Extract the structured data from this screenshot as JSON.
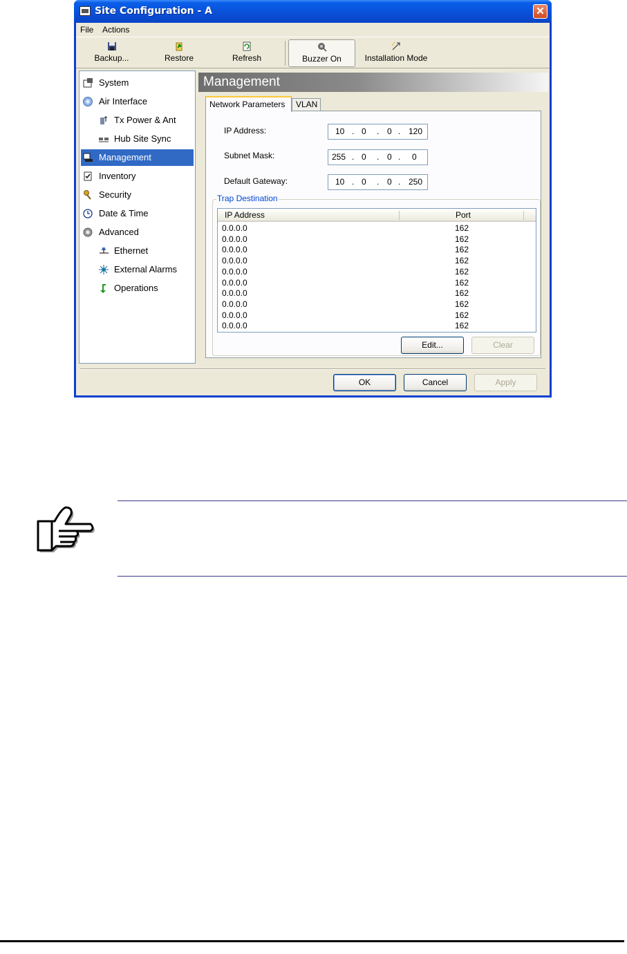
{
  "window": {
    "title": "Site Configuration - A",
    "close_glyph": "✕"
  },
  "menu": [
    "File",
    "Actions"
  ],
  "toolbar": {
    "backup": "Backup...",
    "restore": "Restore",
    "refresh": "Refresh",
    "buzzer": "Buzzer On",
    "installation": "Installation Mode"
  },
  "tree": [
    {
      "label": "System",
      "icon": "system-icon"
    },
    {
      "label": "Air Interface",
      "icon": "air-interface-icon"
    },
    {
      "label": "Tx Power & Ant",
      "icon": "tx-power-icon"
    },
    {
      "label": "Hub Site Sync",
      "icon": "hub-sync-icon"
    },
    {
      "label": "Management",
      "icon": "management-icon",
      "selected": true
    },
    {
      "label": "Inventory",
      "icon": "inventory-icon"
    },
    {
      "label": "Security",
      "icon": "security-icon"
    },
    {
      "label": "Date & Time",
      "icon": "clock-icon"
    },
    {
      "label": "Advanced",
      "icon": "advanced-icon"
    },
    {
      "label": "Ethernet",
      "icon": "ethernet-icon"
    },
    {
      "label": "External Alarms",
      "icon": "alarm-icon"
    },
    {
      "label": "Operations",
      "icon": "operations-icon"
    }
  ],
  "panel": {
    "title": "Management",
    "tabs": [
      "Network Parameters",
      "VLAN"
    ],
    "fields": {
      "ip_label": "IP Address:",
      "ip": [
        "10",
        "0",
        "0",
        "120"
      ],
      "mask_label": "Subnet Mask:",
      "mask": [
        "255",
        "0",
        "0",
        "0"
      ],
      "gateway_label": "Default Gateway:",
      "gateway": [
        "10",
        "0",
        "0",
        "250"
      ],
      "dot": "."
    },
    "trap": {
      "title": "Trap Destination",
      "columns": [
        "IP Address",
        "Port"
      ],
      "rows": [
        [
          "0.0.0.0",
          "162"
        ],
        [
          "0.0.0.0",
          "162"
        ],
        [
          "0.0.0.0",
          "162"
        ],
        [
          "0.0.0.0",
          "162"
        ],
        [
          "0.0.0.0",
          "162"
        ],
        [
          "0.0.0.0",
          "162"
        ],
        [
          "0.0.0.0",
          "162"
        ],
        [
          "0.0.0.0",
          "162"
        ],
        [
          "0.0.0.0",
          "162"
        ],
        [
          "0.0.0.0",
          "162"
        ]
      ],
      "edit": "Edit...",
      "clear": "Clear"
    }
  },
  "buttons": {
    "ok": "OK",
    "cancel": "Cancel",
    "apply": "Apply"
  },
  "colors": {
    "title_bar": "#0a4fd7",
    "selection": "#316ac5",
    "group_title": "#0046d5",
    "tab_highlight": "#ffc83c"
  }
}
